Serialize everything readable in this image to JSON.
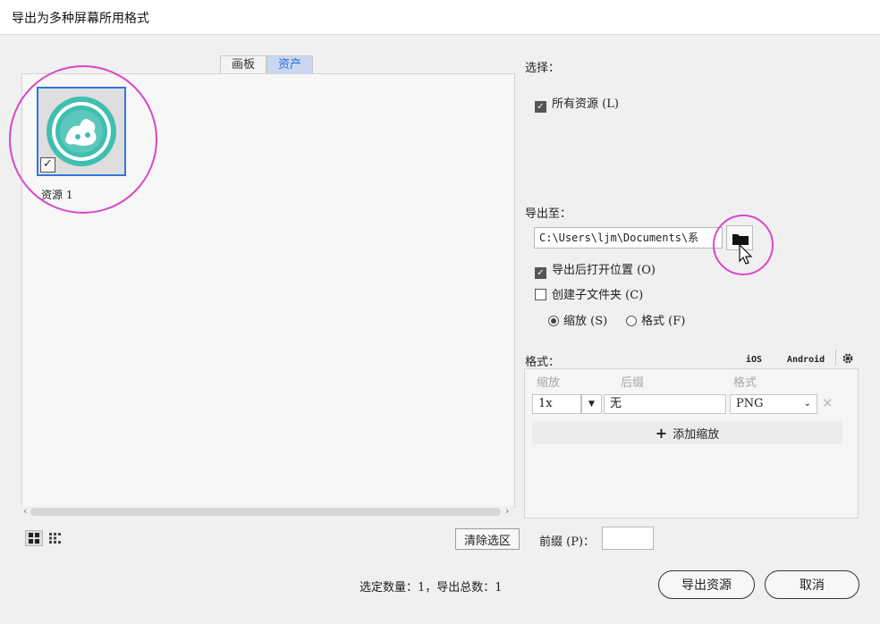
{
  "window": {
    "title": "导出为多种屏幕所用格式"
  },
  "tabs": [
    {
      "label": "画板"
    },
    {
      "label": "资产"
    }
  ],
  "asset": {
    "name": "资源 1",
    "checkmark": "✓"
  },
  "select_section": {
    "label": "选择：",
    "all_assets": {
      "label": "所有资源 (L)",
      "checked": true
    }
  },
  "export_to": {
    "label": "导出至：",
    "path": "C:\\Users\\ljm\\Documents\\系",
    "open_after": {
      "label": "导出后打开位置 (O)",
      "checked": true
    },
    "create_subfolder": {
      "label": "创建子文件夹 (C)",
      "checked": false
    },
    "radio_scale": {
      "label": "缩放 (S)",
      "checked": true
    },
    "radio_format": {
      "label": "格式 (F)",
      "checked": false
    }
  },
  "formats": {
    "label": "格式：",
    "ios_label": "iOS",
    "android_label": "Android",
    "columns": {
      "scale": "缩放",
      "suffix": "后缀",
      "format": "格式"
    },
    "rows": [
      {
        "scale": "1x",
        "suffix": "无",
        "format": "PNG"
      }
    ],
    "add_scale_label": "添加缩放"
  },
  "bottom": {
    "clear_selection": "清除选区",
    "prefix_label": "前缀 (P)：",
    "prefix_value": "",
    "summary": "选定数量：1，导出总数：1",
    "export_button": "导出资源",
    "cancel_button": "取消"
  },
  "colors": {
    "accent": "#2f77d8",
    "annotation": "#d946c9",
    "badge_teal": "#3fbfb0"
  }
}
